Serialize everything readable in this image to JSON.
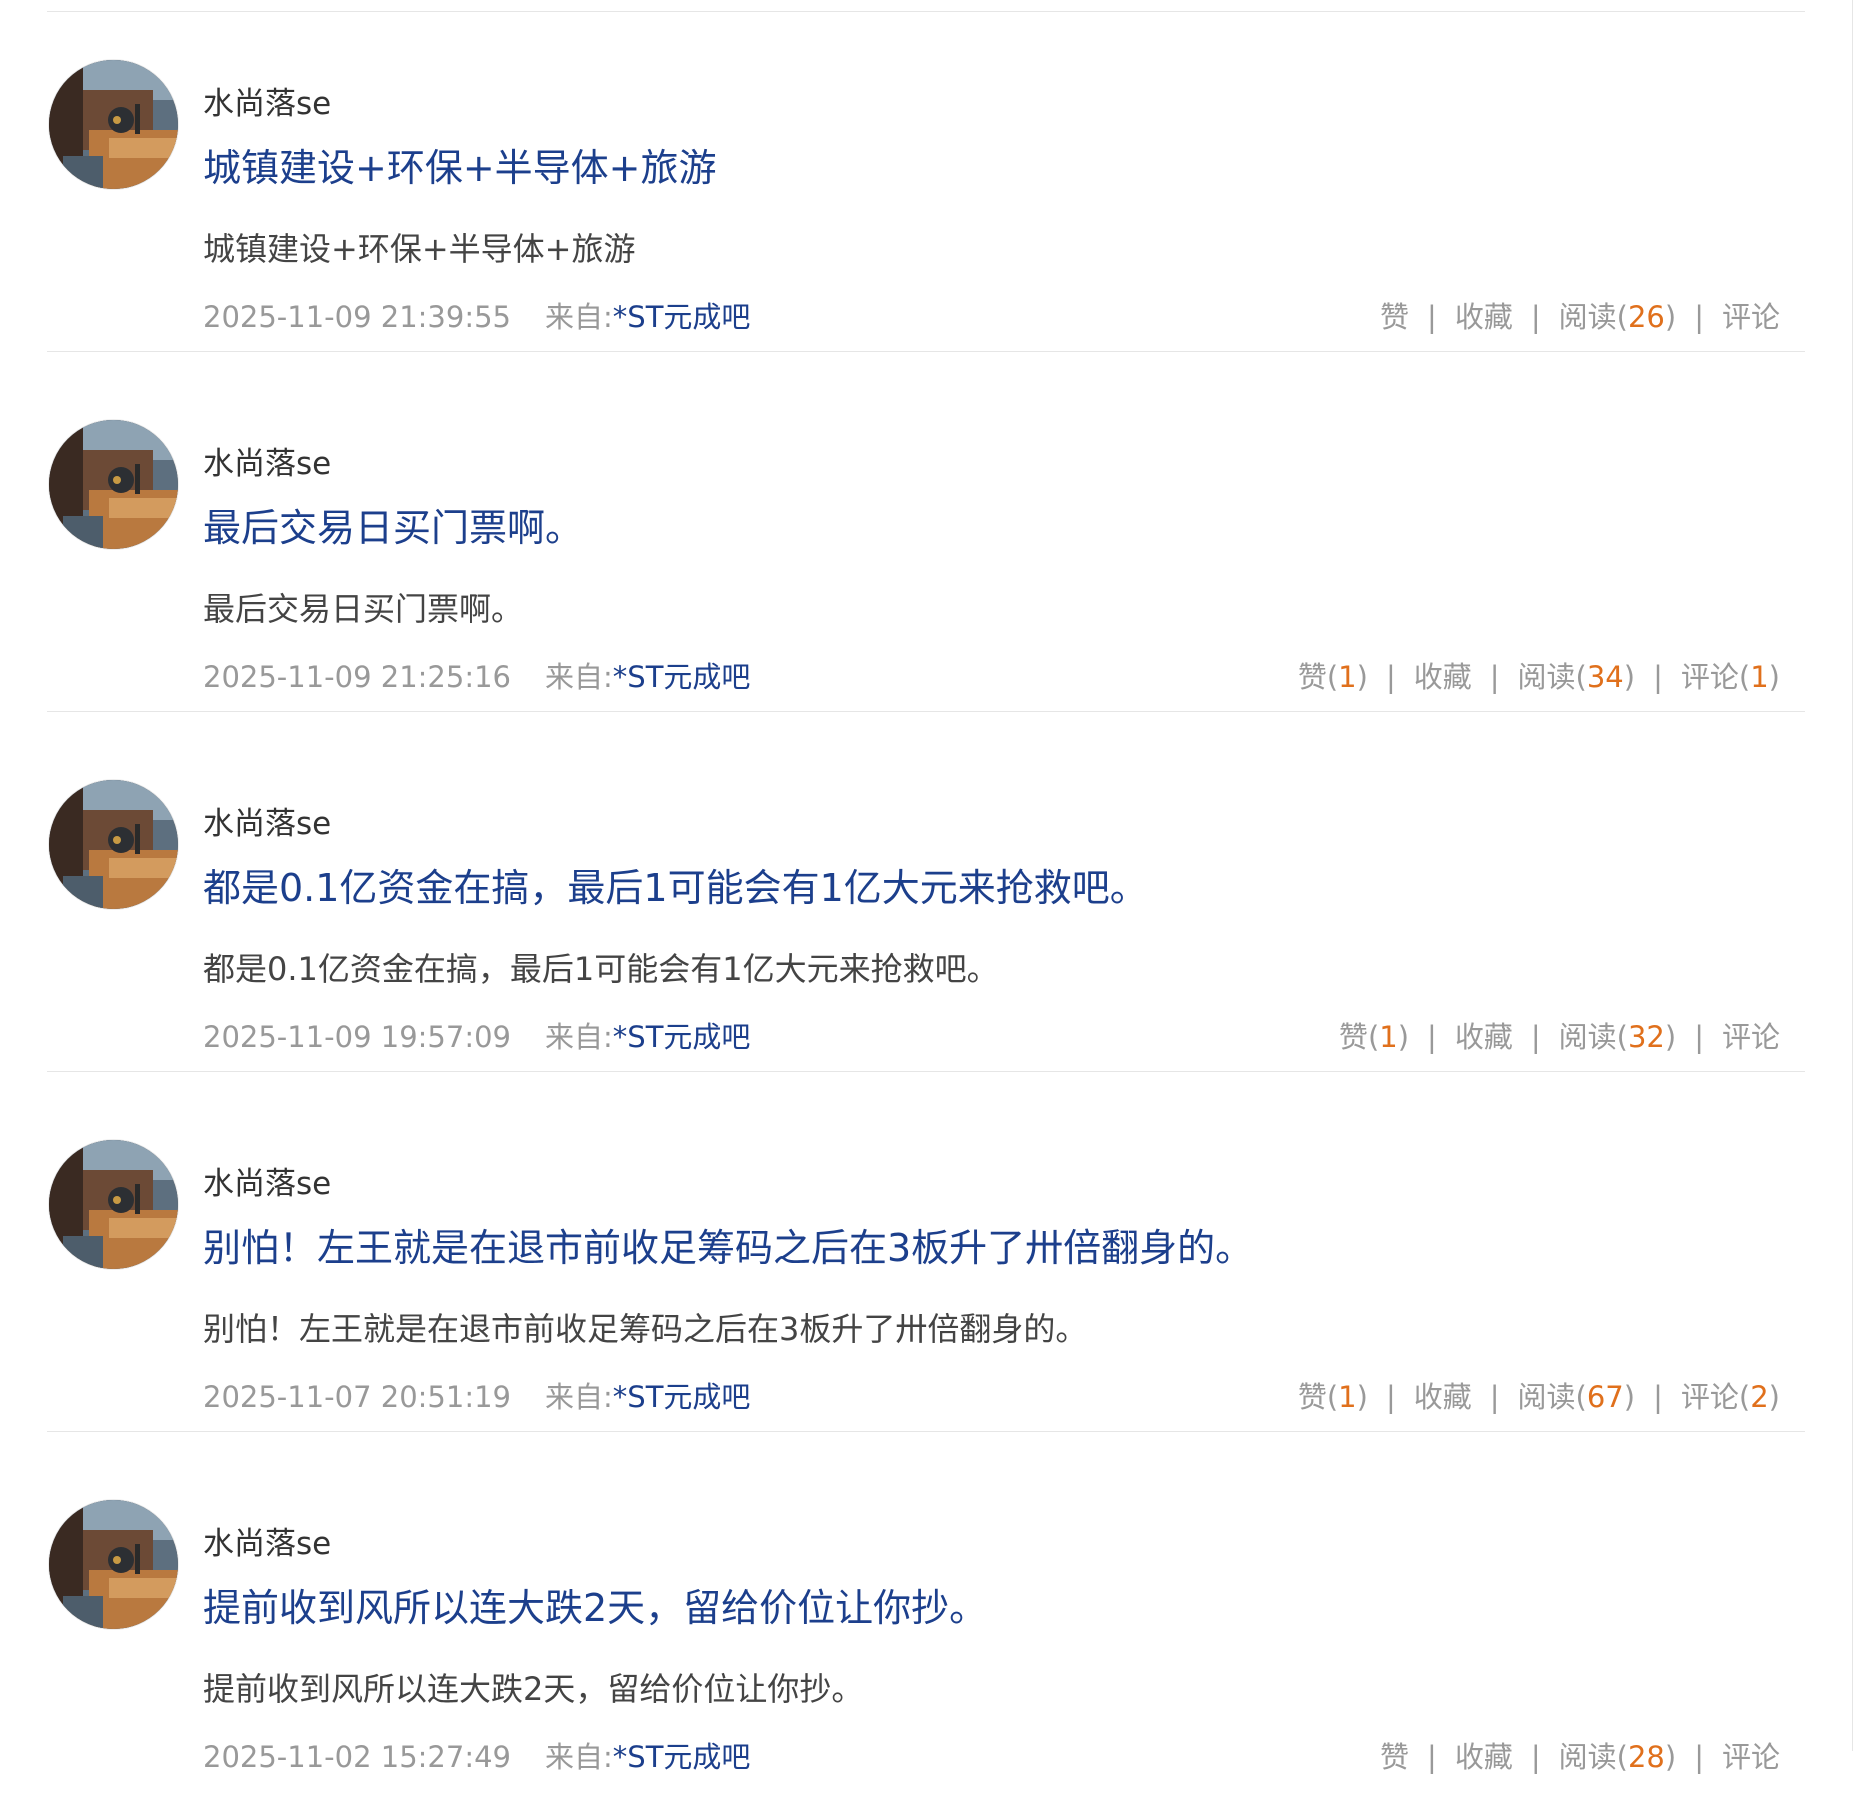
{
  "posts": [
    {
      "author": "水尚落se",
      "title": "城镇建设+环保+半导体+旅游",
      "summary": "城镇建设+环保+半导体+旅游",
      "time": "2025-11-09 21:39:55",
      "from_label": "来自:",
      "source": "*ST元成吧",
      "like_label": "赞",
      "like_count": "",
      "collect_label": "收藏",
      "read_label": "阅读",
      "read_count": "26",
      "comment_label": "评论",
      "comment_count": ""
    },
    {
      "author": "水尚落se",
      "title": "最后交易日买门票啊。",
      "summary": "最后交易日买门票啊。",
      "time": "2025-11-09 21:25:16",
      "from_label": "来自:",
      "source": "*ST元成吧",
      "like_label": "赞",
      "like_count": "1",
      "collect_label": "收藏",
      "read_label": "阅读",
      "read_count": "34",
      "comment_label": "评论",
      "comment_count": "1"
    },
    {
      "author": "水尚落se",
      "title": "都是0.1亿资金在搞，最后1可能会有1亿大元来抢救吧。",
      "summary": "都是0.1亿资金在搞，最后1可能会有1亿大元来抢救吧。",
      "time": "2025-11-09 19:57:09",
      "from_label": "来自:",
      "source": "*ST元成吧",
      "like_label": "赞",
      "like_count": "1",
      "collect_label": "收藏",
      "read_label": "阅读",
      "read_count": "32",
      "comment_label": "评论",
      "comment_count": ""
    },
    {
      "author": "水尚落se",
      "title": "别怕！左王就是在退市前收足筹码之后在3板升了卅倍翻身的。",
      "summary": "别怕！左王就是在退市前收足筹码之后在3板升了卅倍翻身的。",
      "time": "2025-11-07 20:51:19",
      "from_label": "来自:",
      "source": "*ST元成吧",
      "like_label": "赞",
      "like_count": "1",
      "collect_label": "收藏",
      "read_label": "阅读",
      "read_count": "67",
      "comment_label": "评论",
      "comment_count": "2"
    },
    {
      "author": "水尚落se",
      "title": "提前收到风所以连大跌2天，留给价位让你抄。",
      "summary": "提前收到风所以连大跌2天，留给价位让你抄。",
      "time": "2025-11-02 15:27:49",
      "from_label": "来自:",
      "source": "*ST元成吧",
      "like_label": "赞",
      "like_count": "",
      "collect_label": "收藏",
      "read_label": "阅读",
      "read_count": "28",
      "comment_label": "评论",
      "comment_count": ""
    }
  ],
  "colors": {
    "title_link": "#1c3f8c",
    "source_link": "#1c3f8c",
    "count_highlight": "#e0701c",
    "meta_gray": "#999999",
    "divider": "#e6e6e6"
  },
  "icons": {
    "avatar": "user-avatar-photo"
  }
}
